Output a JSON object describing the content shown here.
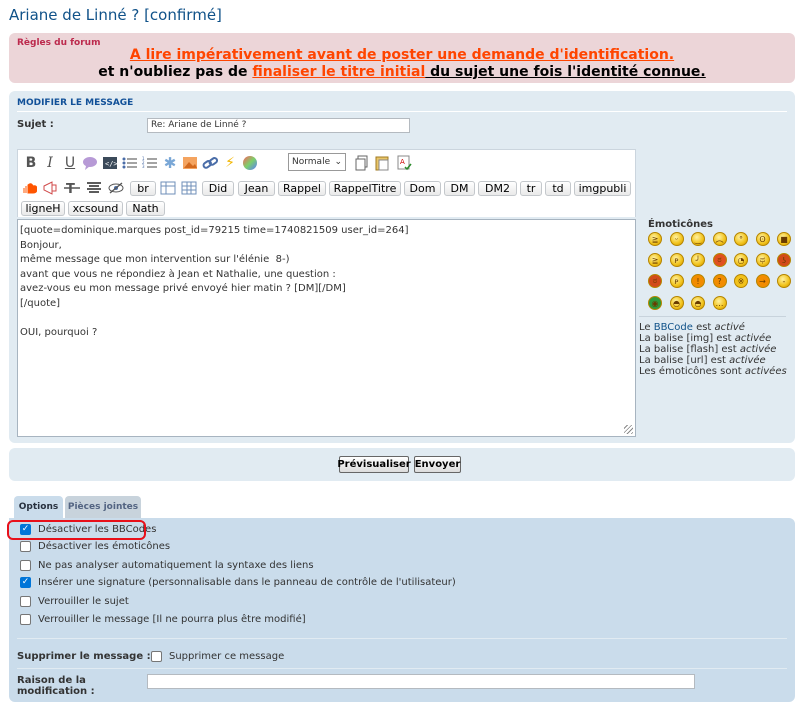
{
  "page_title": "Ariane de Linné ? [confirmé]",
  "rules": {
    "heading": "Règles du forum",
    "line1": "A lire impérativement avant de poster une demande d'identification.",
    "line2_a": "et n'oubliez pas de ",
    "line2_b": "finaliser le titre initial",
    "line2_c": " du sujet une fois l'identité connue."
  },
  "edit_panel": {
    "heading": "MODIFIER LE MESSAGE",
    "subject_label": "Sujet :",
    "subject_value": "Re: Ariane de Linné ?"
  },
  "toolbar": {
    "font_size_select": "Normale",
    "bbcode_buttons": [
      "br",
      "Did",
      "Jean",
      "Rappel",
      "RappelTitre",
      "Dom",
      "DM",
      "DM2",
      "tr",
      "td",
      "imgpubli",
      "ligneH",
      "xcsound",
      "Nath"
    ]
  },
  "editor": {
    "lines": [
      "[quote=dominique.marques post_id=79215 time=1740821509 user_id=264]",
      "Bonjour,",
      "même message que mon intervention sur l'élénie  8-)",
      "avant que vous ne répondiez à Jean et Nathalie, une question :",
      "avez-vous eu mon message privé envoyé hier matin ? [DM][/DM]",
      "[/quote]",
      "",
      "OUI, pourquoi ?"
    ]
  },
  "smilies": {
    "title": "Émoticônes",
    "icons": [
      "laughing",
      "smile",
      "wink",
      "sad",
      "shocked",
      "surprised",
      "cool",
      "lol",
      "tongue",
      "embarrassed",
      "mad",
      "rolleyes",
      "crying",
      "evil",
      "twisted",
      "razz",
      "exclaim",
      "question",
      "idea",
      "arrow",
      "neutral",
      "alien",
      "geek",
      "nerd",
      "thinking"
    ],
    "info": {
      "bbcode": [
        "Le ",
        "BBCode",
        " est ",
        "activé"
      ],
      "img": [
        "La balise [img] est ",
        "activée"
      ],
      "flash": [
        "La balise [flash] est ",
        "activée"
      ],
      "url": [
        "La balise [url] est ",
        "activée"
      ],
      "smilies": [
        "Les émoticônes sont ",
        "activées"
      ]
    }
  },
  "buttons": {
    "preview": "Prévisualiser",
    "submit": "Envoyer"
  },
  "tabs": [
    "Options",
    "Pièces jointes"
  ],
  "options": [
    {
      "label": "Désactiver les BBCodes",
      "checked": true
    },
    {
      "label": "Désactiver les émoticônes",
      "checked": false
    },
    {
      "label": "Ne pas analyser automatiquement la syntaxe des liens",
      "checked": false
    },
    {
      "label": "Insérer une signature (personnalisable dans le panneau de contrôle de l'utilisateur)",
      "checked": true
    },
    {
      "label": "Verrouiller le sujet",
      "checked": false
    },
    {
      "label": "Verrouiller le message [Il ne pourra plus être modifié]",
      "checked": false
    }
  ],
  "delete": {
    "label": "Supprimer le message :",
    "checkbox_label": "Supprimer ce message"
  },
  "reason": {
    "label": "Raison de la modification :",
    "value": ""
  },
  "colors": {
    "panel_bg": "#e1ebf2",
    "options_bg": "#cadceb",
    "rules_bg": "#ecd5d8",
    "accent_orange": "#ff4500",
    "link_blue": "#105289",
    "highlight_red": "#e8101a"
  }
}
